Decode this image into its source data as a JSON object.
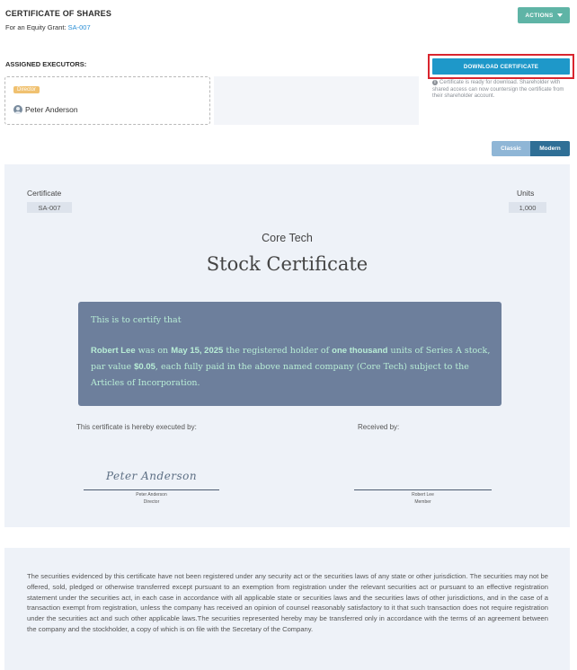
{
  "header": {
    "title": "CERTIFICATE OF SHARES",
    "subtitle_prefix": "For an Equity Grant: ",
    "grant_link": "SA-007",
    "actions_label": "ACTIONS"
  },
  "executors": {
    "label": "ASSIGNED EXECUTORS:",
    "items": [
      {
        "role": "Director",
        "name": "Peter Anderson"
      }
    ]
  },
  "download": {
    "button_label": "DOWNLOAD CERTIFICATE",
    "note": "Certificate is ready for download. Shareholder with shared access can now countersign the certificate from their shareholder account."
  },
  "view_toggle": {
    "options": [
      "Classic",
      "Modern"
    ],
    "selected": "Modern"
  },
  "certificate": {
    "certificate_label": "Certificate",
    "certificate_id": "SA-007",
    "units_label": "Units",
    "units_value": "1,000",
    "company": "Core Tech",
    "title": "Stock Certificate",
    "intro": "This is to certify that",
    "holder": "Robert Lee",
    "text_was_on": " was on ",
    "date": "May 15, 2025",
    "text_registered": " the registered holder of ",
    "quantity_words": "one thousand",
    "text_units_of": " units of Series A stock, par value ",
    "par_value": "$0.05",
    "text_tail": ", each fully paid in the above named company (Core Tech) subject to the Articles of Incorporation.",
    "executed_by_label": "This certificate is hereby executed by:",
    "received_by_label": "Received by:",
    "signature": "Peter Anderson",
    "executor_name": "Peter Anderson",
    "executor_role": "Director",
    "receiver_name": "Robert Lee",
    "receiver_role": "Member"
  },
  "legal": {
    "text": "The securities evidenced by this certificate have not been registered under any security act or the securities laws of any state or other jurisdiction. The securities may not be offered, sold, pledged or otherwise transferred except pursuant to an exemption from registration under the relevant securities act or pursuant to an effective registration statement under the securities act, in each case in accordance with all applicable state or securities laws and the securities laws of other jurisdictions, and in the case of a transaction exempt from registration, unless the company has received an opinion of counsel reasonably satisfactory to it that such transaction does not require registration under the securities act and such other applicable laws.The securities represented hereby may be transferred only in accordance with the terms of an agreement between the company and the stockholder, a copy of which is on file with the Secretary of the Company."
  },
  "colors": {
    "actions": "#5fb4a6",
    "download": "#1e98c9",
    "highlight": "#d9252e",
    "role_badge": "#f0c170",
    "certify_box": "#6d7f9c",
    "certify_text": "#b8edd6",
    "toggle_active": "#2f6f96",
    "toggle_inactive": "#8fb6d6",
    "panel": "#eef2f8"
  }
}
